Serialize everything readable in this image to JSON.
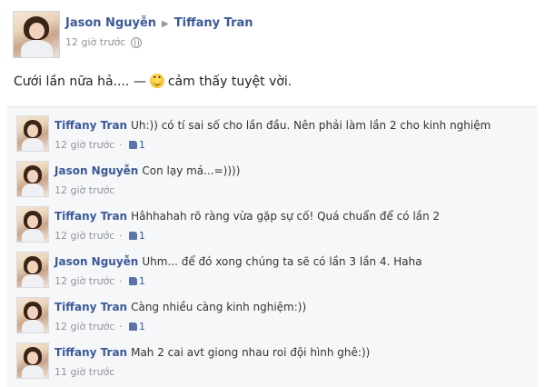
{
  "post": {
    "author": "Jason Nguyễn",
    "target": "Tiffany Tran",
    "time": "12 giờ trước",
    "text_before": "Cưới lần nữa hả.... —",
    "text_after": "cảm thấy tuyệt vời."
  },
  "comments": [
    {
      "author": "Tiffany Tran",
      "text": "Uh:)) có tí sai số cho lần đầu. Nên phải làm lần 2 cho kinh nghiệm",
      "time": "12 giờ trước",
      "likes": "1"
    },
    {
      "author": "Jason Nguyễn",
      "text": "Con lạy má...=))))",
      "time": "12 giờ trước",
      "likes": null
    },
    {
      "author": "Tiffany Tran",
      "text": "Hâhhahah rõ ràng vừa gặp sự cố! Quá chuẩn để có lần 2",
      "time": "12 giờ trước",
      "likes": "1"
    },
    {
      "author": "Jason Nguyễn",
      "text": "Uhm... để đó xong chúng ta sẽ có lần 3 lần 4. Haha",
      "time": "12 giờ trước",
      "likes": "1"
    },
    {
      "author": "Tiffany Tran",
      "text": "Càng nhiều càng kinh nghiệm:))",
      "time": "12 giờ trước",
      "likes": "1"
    },
    {
      "author": "Tiffany Tran",
      "text": "Mah 2 cai avt giong nhau roi đội hình ghê:))",
      "time": "11 giờ trước",
      "likes": null
    }
  ],
  "colors": {
    "link": "#3b5998",
    "meta": "#90949c",
    "comment_bg": "#f6f7f9"
  },
  "icons": {
    "post_privacy": "globe-icon",
    "feeling": "smiley-icon",
    "like": "like-icon"
  }
}
